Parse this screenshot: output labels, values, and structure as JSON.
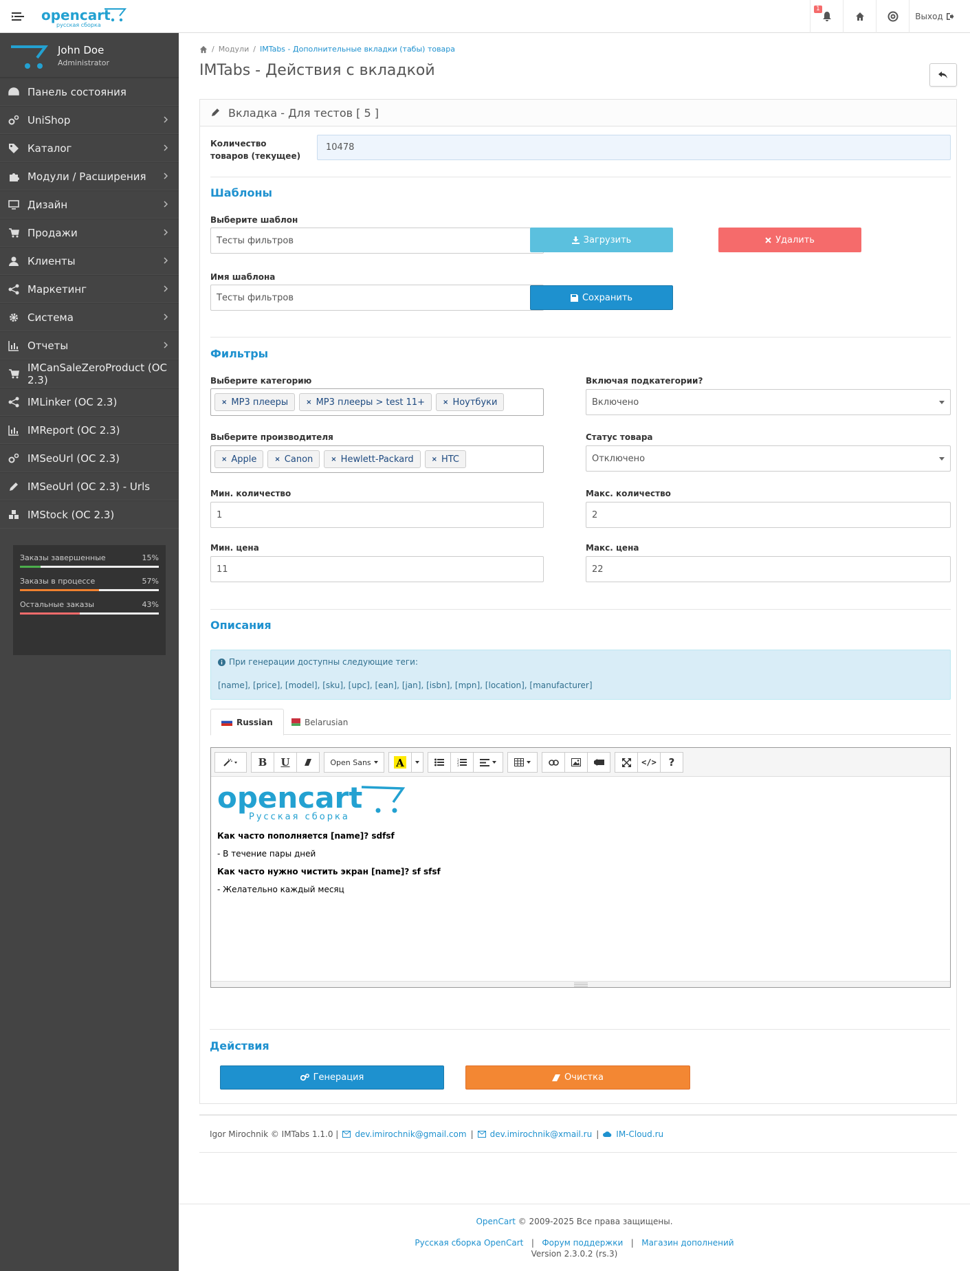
{
  "header": {
    "logo_text": "opencart",
    "logo_sub": "русская сборка",
    "bell_count": "1",
    "logout_label": "Выход"
  },
  "sidebar": {
    "user_name": "John Doe",
    "user_role": "Administrator",
    "items": [
      {
        "label": "Панель состояния",
        "icon": "dashboard-icon",
        "chevron": false
      },
      {
        "label": "UniShop",
        "icon": "cogs-icon",
        "chevron": true
      },
      {
        "label": "Каталог",
        "icon": "tags-icon",
        "chevron": true
      },
      {
        "label": "Модули / Расширения",
        "icon": "puzzle-icon",
        "chevron": true
      },
      {
        "label": "Дизайн",
        "icon": "monitor-icon",
        "chevron": true
      },
      {
        "label": "Продажи",
        "icon": "cart-icon",
        "chevron": true
      },
      {
        "label": "Клиенты",
        "icon": "user-icon",
        "chevron": true
      },
      {
        "label": "Маркетинг",
        "icon": "share-icon",
        "chevron": true
      },
      {
        "label": "Система",
        "icon": "gear-icon",
        "chevron": true
      },
      {
        "label": "Отчеты",
        "icon": "bar-chart-icon",
        "chevron": true
      },
      {
        "label": "IMCanSaleZeroProduct (OC 2.3)",
        "icon": "cart-icon",
        "chevron": false
      },
      {
        "label": "IMLinker (OC 2.3)",
        "icon": "share-icon",
        "chevron": false
      },
      {
        "label": "IMReport (OC 2.3)",
        "icon": "bar-chart-icon",
        "chevron": false
      },
      {
        "label": "IMSeoUrl (OC 2.3)",
        "icon": "cogs-icon",
        "chevron": false
      },
      {
        "label": "IMSeoUrl (OC 2.3) - Urls",
        "icon": "pencil-icon",
        "chevron": false
      },
      {
        "label": "IMStock (OC 2.3)",
        "icon": "cubes-icon",
        "chevron": false
      }
    ],
    "stats": [
      {
        "label": "Заказы завершенные",
        "value": "15%",
        "percent": 15,
        "color": "#4cae4c"
      },
      {
        "label": "Заказы в процессе",
        "value": "57%",
        "percent": 57,
        "color": "#f0812f"
      },
      {
        "label": "Остальные заказы",
        "value": "43%",
        "percent": 43,
        "color": "#f56b6b"
      }
    ]
  },
  "breadcrumb": {
    "home_icon": "home-icon",
    "modules": "Модули",
    "current": "IMTabs - Дополнительные вкладки (табы) товара"
  },
  "page_title": "IMTabs - Действия с вкладкой",
  "panel": {
    "heading": "Вкладка - Для тестов [ 5 ]",
    "product_count_label": "Количество товаров (текущее)",
    "product_count_value": "10478",
    "templates": {
      "title": "Шаблоны",
      "select_label": "Выберите шаблон",
      "select_value": "Тесты фильтров",
      "load_button": "Загрузить",
      "delete_button": "Удалить",
      "name_label": "Имя шаблона",
      "name_value": "Тесты фильтров",
      "save_button": "Сохранить"
    },
    "filters": {
      "title": "Фильтры",
      "category_label": "Выберите категорию",
      "categories": [
        "MP3 плееры",
        "MP3 плееры > test 11+",
        "Ноутбуки"
      ],
      "subcat_label": "Включая подкатегории?",
      "subcat_value": "Включено",
      "manufacturer_label": "Выберите производителя",
      "manufacturers": [
        "Apple",
        "Canon",
        "Hewlett-Packard",
        "HTC"
      ],
      "status_label": "Статус товара",
      "status_value": "Отключено",
      "min_qty_label": "Мин. количество",
      "min_qty_value": "1",
      "max_qty_label": "Макс. количество",
      "max_qty_value": "2",
      "min_price_label": "Мин. цена",
      "min_price_value": "11",
      "max_price_label": "Макс. цена",
      "max_price_value": "22"
    },
    "descriptions": {
      "title": "Описания",
      "info_line1": "При генерации доступны следующие теги:",
      "info_line2": "[name], [price], [model], [sku], [upc], [ean], [jan], [isbn], [mpn], [location], [manufacturer]",
      "tabs": [
        "Russian",
        "Belarusian"
      ],
      "font_name": "Open Sans",
      "editor_logo_text": "opencart",
      "editor_logo_sub": "Русская сборка",
      "content": [
        {
          "text": "Как часто пополняется [name]? sdfsf",
          "bold": true
        },
        {
          "text": "- В течение пары дней",
          "bold": false
        },
        {
          "text": "Как часто нужно чистить экран [name]? sf sfsf",
          "bold": true
        },
        {
          "text": "- Желательно каждый месяц",
          "bold": false
        }
      ]
    },
    "actions": {
      "title": "Действия",
      "generate_button": "Генерация",
      "clear_button": "Очистка"
    }
  },
  "module_footer": {
    "copyright": "Igor Mirochnik © IMTabs 1.1.0 |",
    "email1": "dev.imirochnik@gmail.com",
    "email2": "dev.imirochnik@xmail.ru",
    "site": "IM-Cloud.ru"
  },
  "site_footer": {
    "brand": "OpenCart",
    "copyright": "© 2009-2025 Все права защищены.",
    "link1": "Русская сборка OpenCart",
    "link2": "Форум поддержки",
    "link3": "Магазин дополнений",
    "version": "Version 2.3.0.2 (rs.3)"
  },
  "colors": {
    "accent": "#1e91cf",
    "sidebar_bg": "#444444",
    "btn_info": "#5bc0de",
    "btn_danger": "#f56b6b",
    "btn_primary": "#1e91cf",
    "btn_warning": "#f38733"
  }
}
